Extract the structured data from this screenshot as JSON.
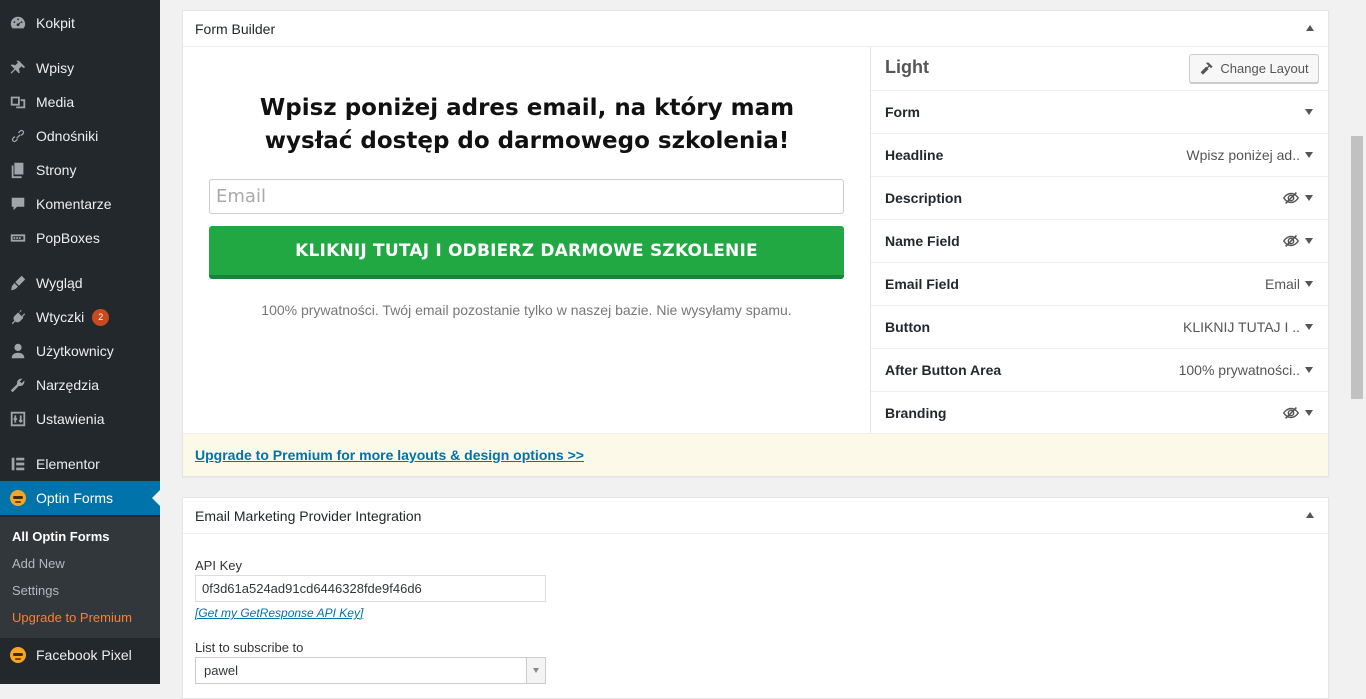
{
  "sidebar": {
    "menu": [
      {
        "label": "Kokpit",
        "icon": "dashboard-icon"
      },
      {
        "label": "Wpisy",
        "icon": "pin-icon"
      },
      {
        "label": "Media",
        "icon": "media-icon"
      },
      {
        "label": "Odnośniki",
        "icon": "link-icon"
      },
      {
        "label": "Strony",
        "icon": "pages-icon"
      },
      {
        "label": "Komentarze",
        "icon": "comment-icon"
      },
      {
        "label": "PopBoxes",
        "icon": "popbox-icon"
      },
      {
        "label": "Wygląd",
        "icon": "brush-icon"
      },
      {
        "label": "Wtyczki",
        "icon": "plugin-icon",
        "badge": "2"
      },
      {
        "label": "Użytkownicy",
        "icon": "users-icon"
      },
      {
        "label": "Narzędzia",
        "icon": "wrench-icon"
      },
      {
        "label": "Ustawienia",
        "icon": "settings-icon"
      },
      {
        "label": "Elementor",
        "icon": "elementor-icon"
      },
      {
        "label": "Optin Forms",
        "icon": "optin-mascot-icon"
      },
      {
        "label": "Facebook Pixel",
        "icon": "pixel-mascot-icon"
      }
    ],
    "submenu": [
      {
        "label": "All Optin Forms"
      },
      {
        "label": "Add New"
      },
      {
        "label": "Settings"
      },
      {
        "label": "Upgrade to Premium"
      }
    ]
  },
  "form_builder": {
    "title": "Form Builder",
    "preview": {
      "headline": "Wpisz poniżej adres email, na który mam wysłać dostęp do darmowego szkolenia!",
      "email_placeholder": "Email",
      "button_label": "KLIKNIJ TUTAJ I ODBIERZ DARMOWE SZKOLENIE",
      "after_text": "100% prywatności. Twój email pozostanie tylko w naszej bazie. Nie wysyłamy spamu.",
      "button_color": "#22a843"
    },
    "settings": {
      "layout_name": "Light",
      "change_layout_label": "Change Layout",
      "rows": [
        {
          "label": "Form",
          "value": ""
        },
        {
          "label": "Headline",
          "value": "Wpisz poniżej ad.."
        },
        {
          "label": "Description",
          "value": "",
          "hidden_icon": true
        },
        {
          "label": "Name Field",
          "value": "",
          "hidden_icon": true
        },
        {
          "label": "Email Field",
          "value": "Email"
        },
        {
          "label": "Button",
          "value": "KLIKNIJ TUTAJ I .."
        },
        {
          "label": "After Button Area",
          "value": "100% prywatności.."
        },
        {
          "label": "Branding",
          "value": "",
          "hidden_icon": true
        }
      ]
    },
    "upgrade_link": "Upgrade to Premium for more layouts & design options >>"
  },
  "integration": {
    "title": "Email Marketing Provider Integration",
    "api_key_label": "API Key",
    "api_key_value": "0f3d61a524ad91cd6446328fde9f46d6",
    "api_link": "[Get my GetResponse API Key]",
    "list_label": "List to subscribe to",
    "list_value": "pawel"
  },
  "colors": {
    "sidebar_bg": "#23282d",
    "active_bg": "#0073aa",
    "upgrade_accent": "#ff7d31",
    "badge": "#ca4a1f"
  }
}
